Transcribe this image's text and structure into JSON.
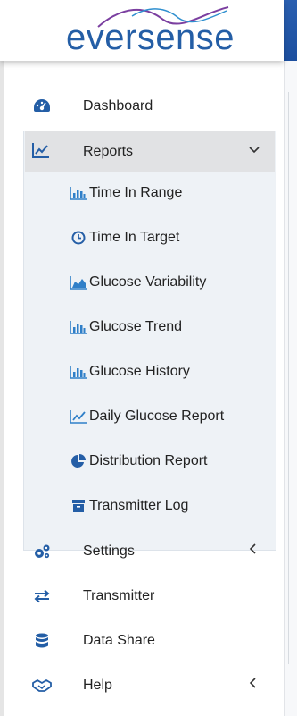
{
  "brand": {
    "logo_text": "eversense"
  },
  "colors": {
    "primary": "#245ea6",
    "accent": "#7b3fa0",
    "group_bg": "#eef2f6",
    "selected_bg": "#e1e2e4"
  },
  "nav": {
    "dashboard": {
      "label": "Dashboard",
      "icon": "dashboard-gauge-icon"
    },
    "reports": {
      "label": "Reports",
      "icon": "line-chart-icon",
      "expanded": true,
      "items": [
        {
          "label": "Time In Range",
          "icon": "bar-chart-icon"
        },
        {
          "label": "Time In Target",
          "icon": "clock-icon"
        },
        {
          "label": "Glucose Variability",
          "icon": "area-chart-icon"
        },
        {
          "label": "Glucose Trend",
          "icon": "bar-chart-icon"
        },
        {
          "label": "Glucose History",
          "icon": "bar-chart-icon"
        },
        {
          "label": "Daily Glucose Report",
          "icon": "line-chart-icon"
        },
        {
          "label": "Distribution Report",
          "icon": "pie-chart-icon"
        },
        {
          "label": "Transmitter Log",
          "icon": "archive-box-icon"
        }
      ]
    },
    "settings": {
      "label": "Settings",
      "icon": "gears-icon"
    },
    "transmitter": {
      "label": "Transmitter",
      "icon": "exchange-arrows-icon"
    },
    "data_share": {
      "label": "Data Share",
      "icon": "database-icon"
    },
    "help": {
      "label": "Help",
      "icon": "handshake-icon"
    }
  }
}
